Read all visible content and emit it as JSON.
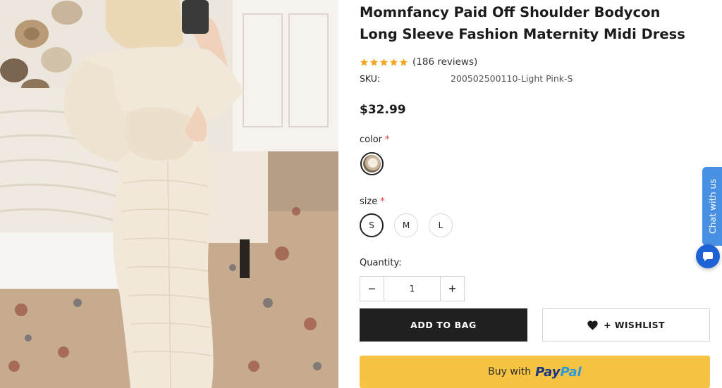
{
  "product": {
    "title": "Momnfancy Paid Off Shoulder Bodycon Long Sleeve Fashion Maternity Midi Dress",
    "rating": 5,
    "reviews_text": "(186 reviews)",
    "sku_label": "SKU:",
    "sku_value": "200502500110-Light Pink-S",
    "price": "$32.99",
    "image_alt": "Woman wearing cream off-shoulder maternity midi dress"
  },
  "options": {
    "color_label": "color",
    "size_label": "size",
    "required_marker": "*",
    "sizes": [
      "S",
      "M",
      "L"
    ],
    "selected_size": "S"
  },
  "quantity": {
    "label": "Quantity:",
    "value": "1",
    "minus": "−",
    "plus": "+"
  },
  "actions": {
    "add_to_bag": "ADD TO BAG",
    "wishlist": "+ WISHLIST",
    "buy_with": "Buy with",
    "paypal_pay": "Pay",
    "paypal_pal": "Pal"
  },
  "chat": {
    "tab_label": "Chat with us"
  },
  "colors": {
    "star": "#f5a623",
    "add_to_bag_bg": "#202020",
    "paypal_bg": "#f6c343",
    "chat_tab_bg": "#4a90e2",
    "chat_bubble_bg": "#1e63d6",
    "required": "#e0413a"
  },
  "icons": [
    "star-icon",
    "heart-icon",
    "chat-icon",
    "minus-icon",
    "plus-icon"
  ]
}
